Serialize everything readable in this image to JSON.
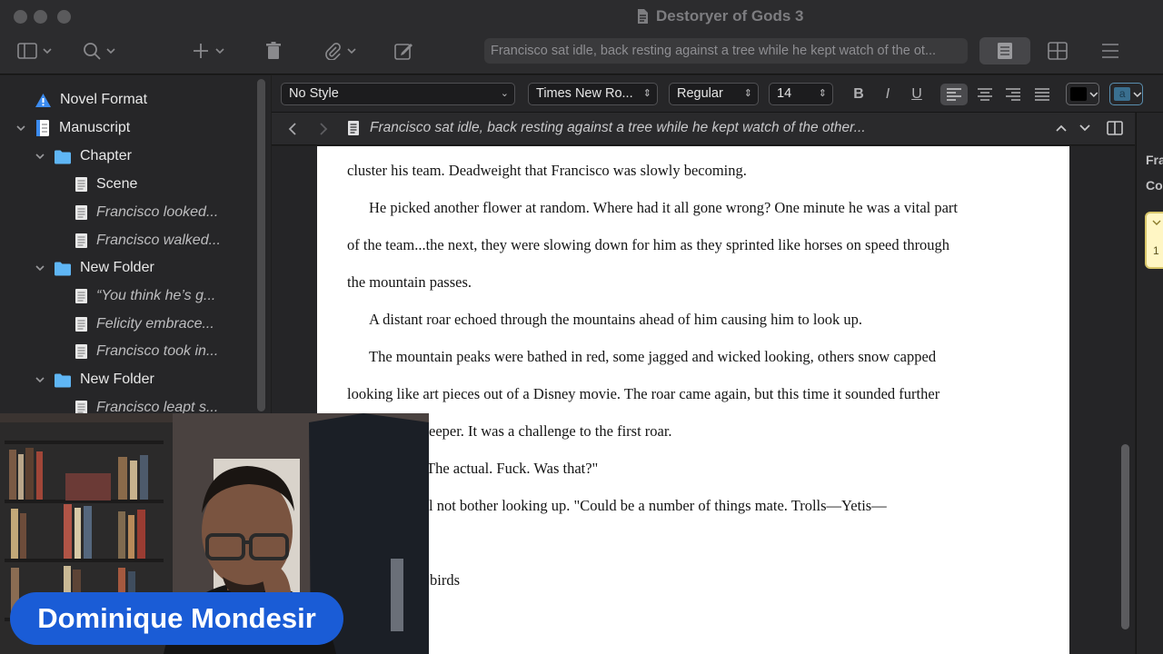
{
  "window": {
    "title": "Destoryer of Gods 3"
  },
  "toolbar": {
    "quick_search_text": "Francisco sat idle, back resting against a tree while he kept watch of the ot..."
  },
  "binder": {
    "items": [
      {
        "label": "Novel Format",
        "icon": "warning-icon",
        "indent": 0,
        "italic": false
      },
      {
        "label": "Manuscript",
        "icon": "manuscript-icon",
        "indent": 0,
        "italic": false
      },
      {
        "label": "Chapter",
        "icon": "folder-icon",
        "indent": 1,
        "italic": false
      },
      {
        "label": "Scene",
        "icon": "document-icon",
        "indent": 2,
        "italic": false
      },
      {
        "label": "Francisco looked...",
        "icon": "document-icon",
        "indent": 2,
        "italic": true
      },
      {
        "label": "Francisco walked...",
        "icon": "document-icon",
        "indent": 2,
        "italic": true
      },
      {
        "label": "New Folder",
        "icon": "folder-icon",
        "indent": 1,
        "italic": false
      },
      {
        "label": "“You think he’s g...",
        "icon": "document-icon",
        "indent": 2,
        "italic": true
      },
      {
        "label": "Felicity embrace...",
        "icon": "document-icon",
        "indent": 2,
        "italic": true
      },
      {
        "label": "Francisco took in...",
        "icon": "document-icon",
        "indent": 2,
        "italic": true
      },
      {
        "label": "New Folder",
        "icon": "folder-icon",
        "indent": 1,
        "italic": false
      },
      {
        "label": "Francisco leapt s...",
        "icon": "document-icon",
        "indent": 2,
        "italic": true
      }
    ]
  },
  "format_bar": {
    "style": "No Style",
    "font_family": "Times New Ro...",
    "font_weight": "Regular",
    "font_size": "14",
    "bold_label": "B",
    "italic_label": "I",
    "underline_label": "U",
    "highlight_label": "a",
    "text_color": "#000000",
    "highlight_color": "#3a6f8f"
  },
  "header": {
    "document_title": "Francisco sat idle, back resting against a tree while he kept watch of the other..."
  },
  "editor": {
    "lines": [
      "cluster his team. Deadweight that Francisco was slowly becoming.",
      "He picked another flower at random. Where had it all gone wrong? One minute he was a vital part",
      "of the team...the next, they were slowing down for him as they sprinted like horses on speed through",
      "the mountain passes.",
      "A distant roar echoed through the mountains ahead of him causing him to look up.",
      "The mountain peaks were bathed in red, some jagged and wicked looking, others snow capped",
      "looking like art pieces out of a Disney movie. The roar came again, but this time it sounded further",
      "eeper. It was a challenge to the first roar.",
      "The actual. Fuck. Was that?\"",
      "l not bother looking up. \"Could be a number of things mate. Trolls—Yetis—",
      "birds"
    ]
  },
  "inspector": {
    "line1": "Fra",
    "line2": "Co",
    "note_text": "1"
  },
  "webcam": {
    "presenter_name": "Dominique Mondesir"
  }
}
